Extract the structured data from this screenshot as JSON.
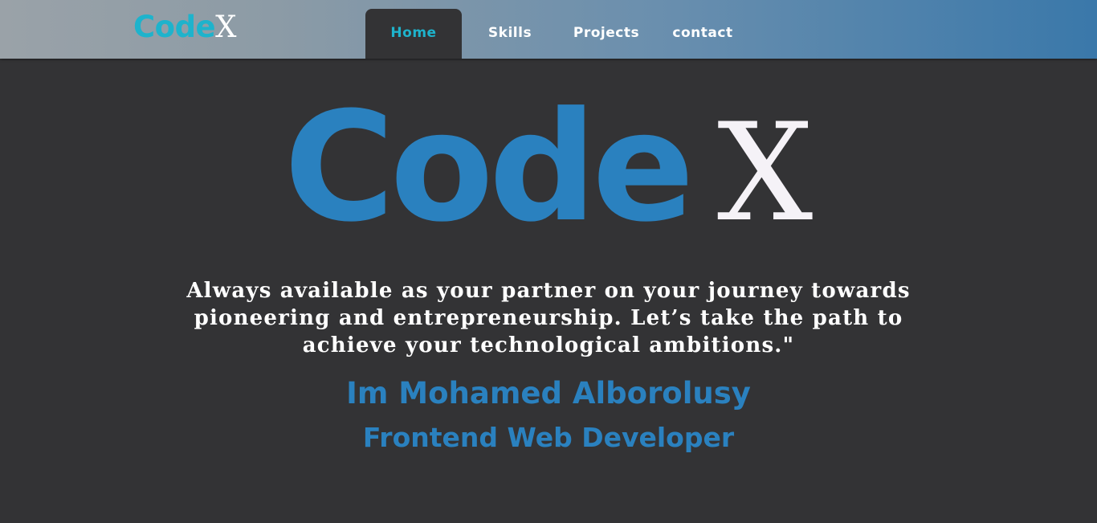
{
  "navbar": {
    "logo": {
      "code": "Code",
      "x": "X"
    },
    "links": [
      {
        "label": "Home",
        "active": true
      },
      {
        "label": "Skills",
        "active": false
      },
      {
        "label": "Projects",
        "active": false
      },
      {
        "label": "contact",
        "active": false
      }
    ]
  },
  "hero": {
    "logo": {
      "code": "Code",
      "x": "X"
    },
    "tagline": "Always available as your partner on your journey towards pioneering and entrepreneurship. Let’s take the path to achieve your technological ambitions.\"",
    "name": "Im Mohamed Alborolusy",
    "role": "Frontend Web Developer"
  },
  "colors": {
    "accent_cyan": "#1eb3cc",
    "accent_blue": "#2a81bf",
    "background": "#333335",
    "text": "#ffffff"
  }
}
